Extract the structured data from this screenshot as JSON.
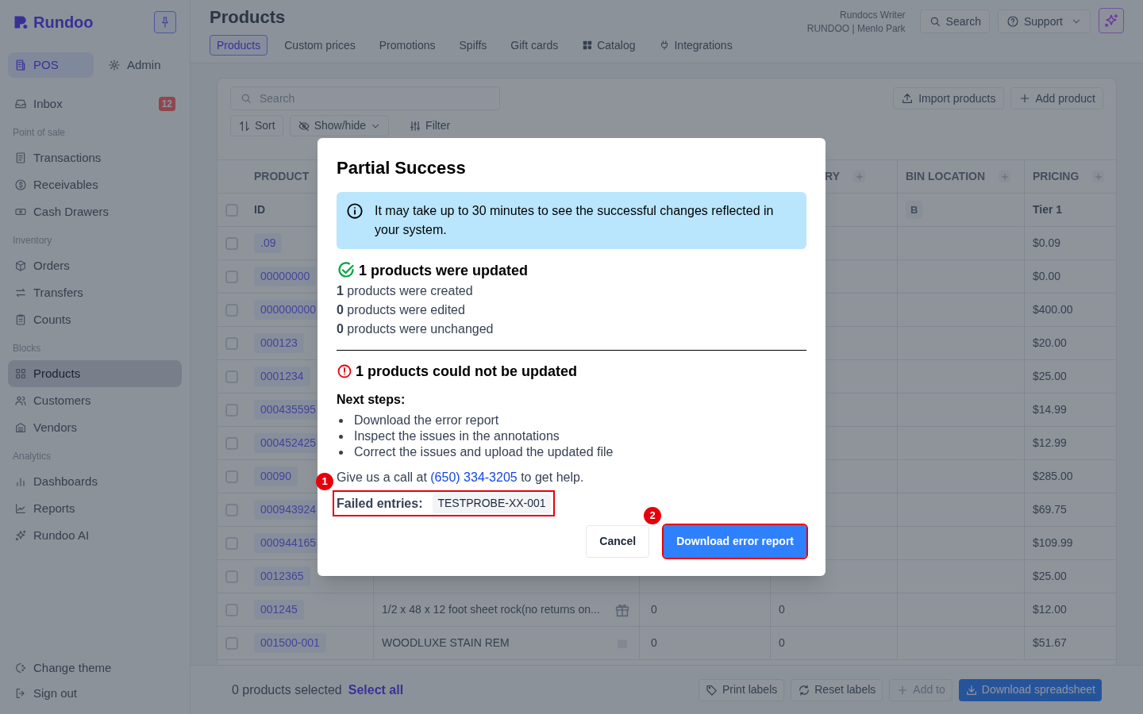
{
  "sidebar": {
    "logo": "Rundoo",
    "modes": [
      {
        "label": "POS",
        "selected": true
      },
      {
        "label": "Admin",
        "selected": false
      }
    ],
    "inbox": {
      "label": "Inbox",
      "badge": "12"
    },
    "sections": [
      {
        "title": "Point of sale",
        "items": [
          {
            "label": "Transactions",
            "selected": false
          },
          {
            "label": "Receivables",
            "selected": false
          },
          {
            "label": "Cash Drawers",
            "selected": false
          }
        ]
      },
      {
        "title": "Inventory",
        "items": [
          {
            "label": "Orders",
            "selected": false
          },
          {
            "label": "Transfers",
            "selected": false
          },
          {
            "label": "Counts",
            "selected": false
          }
        ]
      },
      {
        "title": "Blocks",
        "items": [
          {
            "label": "Products",
            "selected": true
          },
          {
            "label": "Customers",
            "selected": false
          },
          {
            "label": "Vendors",
            "selected": false
          }
        ]
      },
      {
        "title": "Analytics",
        "items": [
          {
            "label": "Dashboards",
            "selected": false
          },
          {
            "label": "Reports",
            "selected": false
          },
          {
            "label": "Rundoo AI",
            "selected": false
          }
        ]
      }
    ],
    "footer": [
      "Change theme",
      "Sign out"
    ]
  },
  "header": {
    "title": "Products",
    "tabs": [
      {
        "label": "Products",
        "selected": true
      },
      {
        "label": "Custom prices",
        "selected": false
      },
      {
        "label": "Promotions",
        "selected": false
      },
      {
        "label": "Spiffs",
        "selected": false
      },
      {
        "label": "Gift cards",
        "selected": false
      },
      {
        "label": "Catalog",
        "selected": false
      },
      {
        "label": "Integrations",
        "selected": false
      }
    ],
    "user": {
      "name": "Rundocs Writer",
      "store": "RUNDOO | Menlo Park"
    },
    "search_button": "Search",
    "support_button": "Support"
  },
  "toolbar": {
    "search": {
      "placeholder": "Search"
    },
    "actions": [
      "Import products",
      "Add product"
    ],
    "controls": [
      "Sort",
      "Show/hide",
      "Filter"
    ]
  },
  "table": {
    "columns": [
      {
        "label": "PRODUCT"
      },
      {
        "label": "RY"
      },
      {
        "label": "BIN LOCATION"
      },
      {
        "label": "PRICING"
      }
    ],
    "subheader": {
      "id": "ID",
      "bin": "B",
      "pricing": "Tier 1",
      "checked": false
    },
    "rows": [
      {
        "id": ".09",
        "price": "$0.09",
        "checked": false
      },
      {
        "id": "00000000",
        "price": "$0.00",
        "checked": false
      },
      {
        "id": "000000000",
        "price": "$400.00",
        "checked": false
      },
      {
        "id": "000123",
        "price": "$20.00",
        "checked": false
      },
      {
        "id": "0001234",
        "price": "$25.00",
        "checked": false
      },
      {
        "id": "000435595",
        "price": "$14.99",
        "checked": false
      },
      {
        "id": "000452425",
        "price": "$12.99",
        "checked": false
      },
      {
        "id": "00090",
        "price": "$285.00",
        "checked": false
      },
      {
        "id": "000943924",
        "price": "$69.75",
        "checked": false
      },
      {
        "id": "000944165",
        "price": "$109.99",
        "checked": false
      },
      {
        "id": "0012365",
        "price": "$25.00",
        "checked": false
      },
      {
        "id": "001245",
        "name": "1/2 x 48 x 12 foot sheet rock(no returns on...",
        "kind": "gift",
        "column_3": "0",
        "column_4": "0",
        "price": "$12.00",
        "checked": false
      },
      {
        "id": "001500-001",
        "name": "WOODLUXE STAIN REM",
        "kind": "plain",
        "column_3": "0",
        "column_4": "0",
        "price": "$51.67",
        "checked": false
      }
    ]
  },
  "bottom_bar": {
    "selected_count": "0 products selected",
    "select_all": "Select all",
    "actions": [
      {
        "label": "Print labels",
        "kind": "default",
        "disabled": false
      },
      {
        "label": "Reset labels",
        "kind": "default",
        "disabled": false
      },
      {
        "label": "Add to",
        "kind": "default",
        "disabled": true
      },
      {
        "label": "Download spreadsheet",
        "kind": "primary",
        "disabled": false
      }
    ]
  },
  "modal": {
    "title": "Partial Success",
    "notice": "It may take up to 30 minutes to see the successful changes reflected in your system.",
    "success": {
      "heading": "1 products were updated",
      "lines": [
        "**1** products were created",
        "**0** products were edited",
        "**0** products were unchanged"
      ]
    },
    "error": {
      "heading": "1 products could not be updated",
      "steps_title": "Next steps:",
      "steps": [
        "Download the error report",
        "Inspect the issues in the annotations",
        "Correct the issues and upload the updated file"
      ]
    },
    "help": {
      "before": "Give us a call at",
      "phone": "(650) 334-3205",
      "after": "to get help."
    },
    "failed_entries": {
      "label": "Failed entries:",
      "entries": [
        "TESTPROBE-XX-001"
      ],
      "highlighted": true,
      "marker": "1"
    },
    "buttons": [
      {
        "label": "Cancel",
        "kind": "default",
        "highlighted": false
      },
      {
        "label": "Download error report",
        "kind": "primary",
        "highlighted": true,
        "marker": "2"
      }
    ]
  }
}
